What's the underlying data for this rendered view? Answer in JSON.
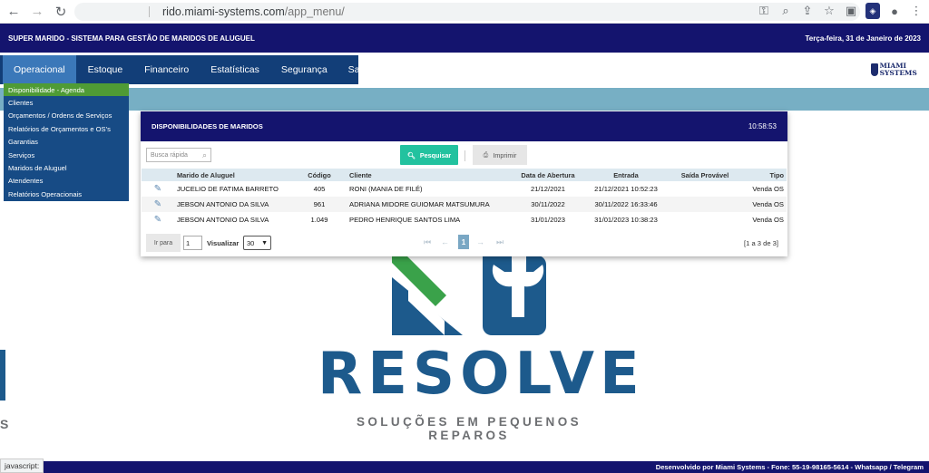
{
  "browser": {
    "url_host": "rido.miami-systems.com",
    "url_path": "/app_menu/",
    "status_text": "javascript:"
  },
  "header": {
    "title": "SUPER MARIDO - SISTEMA PARA GESTÃO DE MARIDOS DE ALUGUEL",
    "date": "Terça-feira, 31 de Janeiro de 2023"
  },
  "menu": {
    "items": [
      "Operacional",
      "Estoque",
      "Financeiro",
      "Estatísticas",
      "Segurança",
      "Sair"
    ],
    "active_index": 0
  },
  "dropdown": {
    "items": [
      "Disponibilidade - Agenda",
      "Clientes",
      "Orçamentos / Ordens de Serviços",
      "Relatórios de Orçamentos e OS's",
      "Garantias",
      "Serviços",
      "Maridos de Aluguel",
      "Atendentes",
      "Relatórios Operacionais"
    ],
    "selected_index": 0
  },
  "small_logo": {
    "name": "MIAMI SYSTEMS"
  },
  "panel": {
    "title": "DISPONIBILIDADES DE MARIDOS",
    "clock": "10:58:53",
    "search_placeholder": "Busca rápida",
    "search_button": "Pesquisar",
    "print_button": "Imprimir",
    "columns": [
      "Marido de Aluguel",
      "Código",
      "Cliente",
      "Data de Abertura",
      "Entrada",
      "Saída Provável",
      "Tipo"
    ],
    "rows": [
      [
        "JUCELIO DE FATIMA BARRETO",
        "405",
        "RONI (MANIA DE FILÉ)",
        "21/12/2021",
        "21/12/2021 10:52:23",
        "",
        "Venda OS"
      ],
      [
        "JEBSON ANTONIO DA SILVA",
        "961",
        "ADRIANA MIDORE GUIOMAR MATSUMURA",
        "30/11/2022",
        "30/11/2022 16:33:46",
        "",
        "Venda OS"
      ],
      [
        "JEBSON ANTONIO DA SILVA",
        "1.049",
        "PEDRO HENRIQUE SANTOS LIMA",
        "31/01/2023",
        "31/01/2023 10:38:23",
        "",
        "Venda OS"
      ]
    ],
    "pager": {
      "goto_label": "Ir para",
      "page_value": "1",
      "view_label": "Visualizar",
      "view_value": "30",
      "current_page": "1",
      "info": "[1 a 3 de 3]"
    }
  },
  "brand": {
    "main": "RESOLVE",
    "tagline": "SOLUÇÕES EM PEQUENOS REPAROS",
    "left_fragment": "S"
  },
  "footer": {
    "text": "Desenvolvido por Miami Systems - Fone: 55-19-98165-5614 - Whatsapp / Telegram"
  },
  "colors": {
    "header": "#14146e",
    "menu": "#123e78",
    "menu_active": "#3b78b9",
    "band": "#77afc4",
    "search_button": "#22c29f",
    "brand_blue": "#1d5a8c",
    "brand_green": "#3aa24a"
  },
  "icons": [
    "back-icon",
    "forward-icon",
    "reload-icon",
    "key-icon",
    "zoom-icon",
    "share-icon",
    "star-icon",
    "sidebar-icon",
    "extension-icon",
    "profile-icon",
    "menu-dots-icon"
  ]
}
